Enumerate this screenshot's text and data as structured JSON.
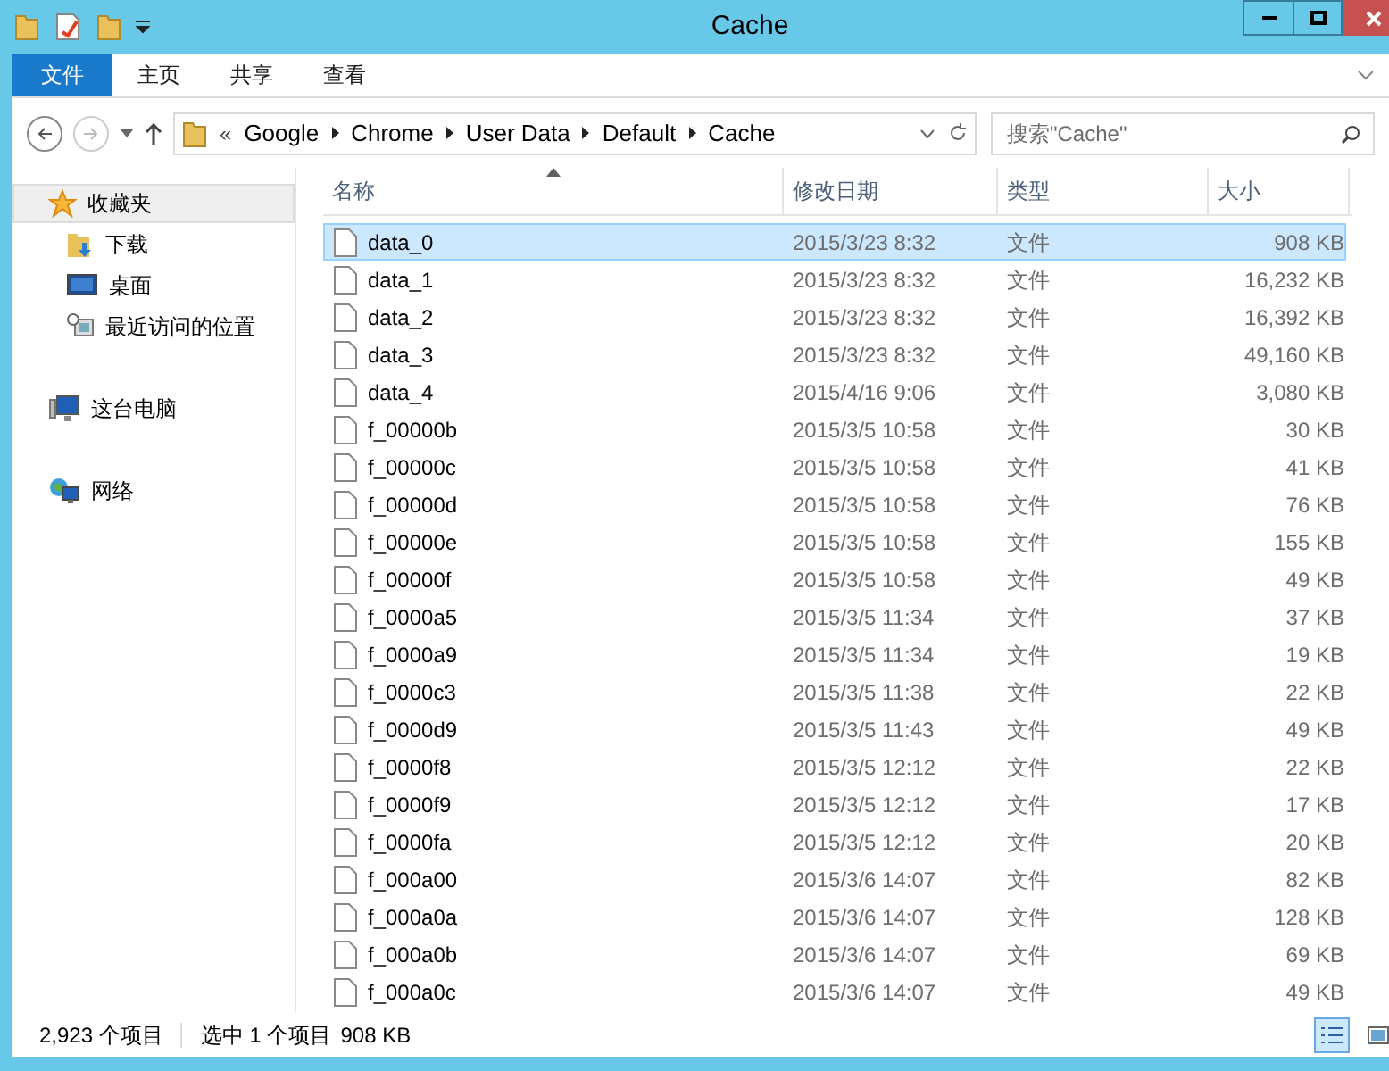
{
  "window": {
    "title": "Cache"
  },
  "ribbon_tabs": [
    {
      "label": "文件",
      "kind": "file"
    },
    {
      "label": "主页",
      "kind": "tab"
    },
    {
      "label": "共享",
      "kind": "tab"
    },
    {
      "label": "查看",
      "kind": "tab"
    }
  ],
  "address": {
    "path": [
      "Google",
      "Chrome",
      "User Data",
      "Default",
      "Cache"
    ],
    "overflow": "«"
  },
  "search": {
    "placeholder": "搜索\"Cache\""
  },
  "sidebar": [
    {
      "label": "收藏夹",
      "kind": "favorites",
      "selected": true,
      "children": [
        {
          "label": "下载",
          "kind": "downloads",
          "selected": false
        },
        {
          "label": "桌面",
          "kind": "desktop",
          "selected": false
        },
        {
          "label": "最近访问的位置",
          "kind": "recent",
          "selected": false
        }
      ]
    },
    {
      "label": "这台电脑",
      "kind": "computer",
      "selected": false
    },
    {
      "label": "网络",
      "kind": "network",
      "selected": false
    }
  ],
  "columns": [
    {
      "label": "名称",
      "sorted": true
    },
    {
      "label": "修改日期",
      "sorted": false
    },
    {
      "label": "类型",
      "sorted": false
    },
    {
      "label": "大小",
      "sorted": false
    }
  ],
  "rows": [
    {
      "name": "data_0",
      "date": "2015/3/23 8:32",
      "type": "文件",
      "size": "908 KB",
      "selected": true
    },
    {
      "name": "data_1",
      "date": "2015/3/23 8:32",
      "type": "文件",
      "size": "16,232 KB",
      "selected": false
    },
    {
      "name": "data_2",
      "date": "2015/3/23 8:32",
      "type": "文件",
      "size": "16,392 KB",
      "selected": false
    },
    {
      "name": "data_3",
      "date": "2015/3/23 8:32",
      "type": "文件",
      "size": "49,160 KB",
      "selected": false
    },
    {
      "name": "data_4",
      "date": "2015/4/16 9:06",
      "type": "文件",
      "size": "3,080 KB",
      "selected": false
    },
    {
      "name": "f_00000b",
      "date": "2015/3/5 10:58",
      "type": "文件",
      "size": "30 KB",
      "selected": false
    },
    {
      "name": "f_00000c",
      "date": "2015/3/5 10:58",
      "type": "文件",
      "size": "41 KB",
      "selected": false
    },
    {
      "name": "f_00000d",
      "date": "2015/3/5 10:58",
      "type": "文件",
      "size": "76 KB",
      "selected": false
    },
    {
      "name": "f_00000e",
      "date": "2015/3/5 10:58",
      "type": "文件",
      "size": "155 KB",
      "selected": false
    },
    {
      "name": "f_00000f",
      "date": "2015/3/5 10:58",
      "type": "文件",
      "size": "49 KB",
      "selected": false
    },
    {
      "name": "f_0000a5",
      "date": "2015/3/5 11:34",
      "type": "文件",
      "size": "37 KB",
      "selected": false
    },
    {
      "name": "f_0000a9",
      "date": "2015/3/5 11:34",
      "type": "文件",
      "size": "19 KB",
      "selected": false
    },
    {
      "name": "f_0000c3",
      "date": "2015/3/5 11:38",
      "type": "文件",
      "size": "22 KB",
      "selected": false
    },
    {
      "name": "f_0000d9",
      "date": "2015/3/5 11:43",
      "type": "文件",
      "size": "49 KB",
      "selected": false
    },
    {
      "name": "f_0000f8",
      "date": "2015/3/5 12:12",
      "type": "文件",
      "size": "22 KB",
      "selected": false
    },
    {
      "name": "f_0000f9",
      "date": "2015/3/5 12:12",
      "type": "文件",
      "size": "17 KB",
      "selected": false
    },
    {
      "name": "f_0000fa",
      "date": "2015/3/5 12:12",
      "type": "文件",
      "size": "20 KB",
      "selected": false
    },
    {
      "name": "f_000a00",
      "date": "2015/3/6 14:07",
      "type": "文件",
      "size": "82 KB",
      "selected": false
    },
    {
      "name": "f_000a0a",
      "date": "2015/3/6 14:07",
      "type": "文件",
      "size": "128 KB",
      "selected": false
    },
    {
      "name": "f_000a0b",
      "date": "2015/3/6 14:07",
      "type": "文件",
      "size": "69 KB",
      "selected": false
    },
    {
      "name": "f_000a0c",
      "date": "2015/3/6 14:07",
      "type": "文件",
      "size": "49 KB",
      "selected": false
    }
  ],
  "status_bar": {
    "count": "2,923 个项目",
    "selection": "选中 1 个项目",
    "selection_size": "908 KB"
  }
}
